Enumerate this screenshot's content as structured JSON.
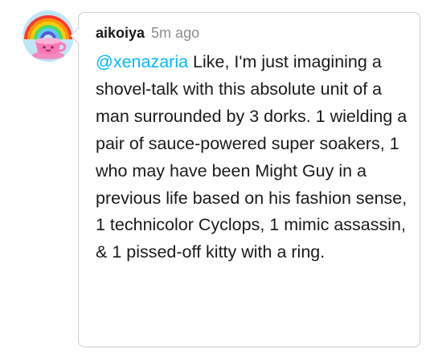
{
  "reply": {
    "username": "aikoiya",
    "timestamp": "5m ago",
    "mention": "@xenazaria",
    "body": " Like, I'm just imagining a shovel-talk with this absolute unit of a man surrounded by 3 dorks. 1 wielding a pair of sauce-powered super soakers, 1 who may have been Might Guy in a previous life based on his fashion sense, 1 technicolor Cyclops, 1 mimic assassin, & 1 pissed-off kitty with a ring."
  },
  "colors": {
    "mention": "#00b8ff",
    "username": "#1a1a1a",
    "timestamp": "#8c8c8c",
    "border": "#cfcfcf"
  }
}
